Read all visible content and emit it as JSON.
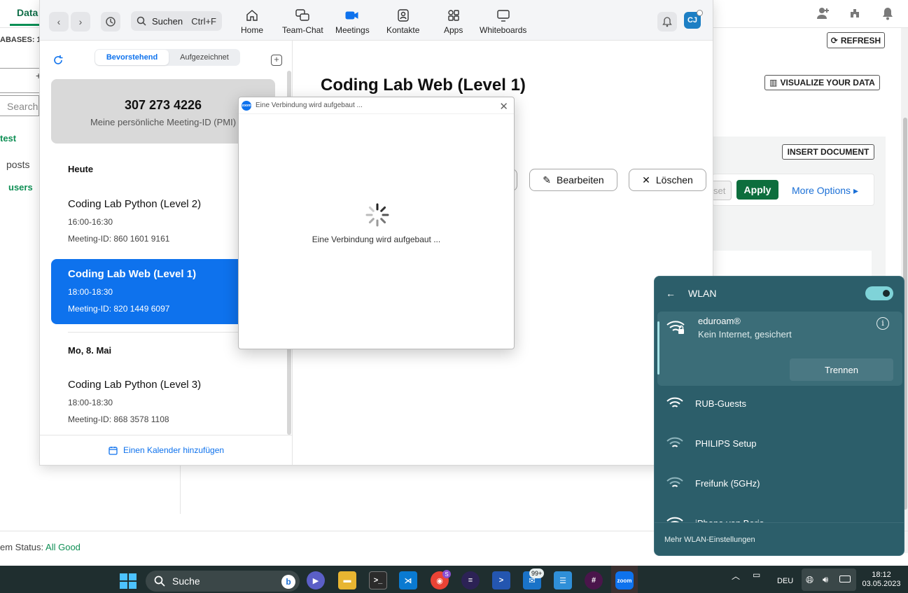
{
  "browser": {
    "tab_data": "Data",
    "databases_label": "ABASES: 1",
    "search_placeholder": "Search",
    "db_name": "test",
    "collections": [
      "posts",
      "users"
    ],
    "refresh_label": "REFRESH",
    "visualize_label": "VISUALIZE YOUR DATA",
    "insert_label": "INSERT DOCUMENT",
    "reset_label": "set",
    "apply_label": "Apply",
    "more_options_label": "More Options",
    "status_prefix": "em Status:",
    "status_value": "All Good"
  },
  "zoom": {
    "search_label": "Suchen",
    "search_shortcut": "Ctrl+F",
    "nav": [
      "Home",
      "Team-Chat",
      "Meetings",
      "Kontakte",
      "Apps",
      "Whiteboards"
    ],
    "avatar_initials": "CJ",
    "tabs": {
      "upcoming": "Bevorstehend",
      "recorded": "Aufgezeichnet"
    },
    "pmi": {
      "number": "307 273 4226",
      "label": "Meine persönliche Meeting-ID (PMI)"
    },
    "day1": "Heute",
    "day2": "Mo, 8. Mai",
    "meetings": [
      {
        "title": "Coding Lab Python (Level 2)",
        "time": "16:00-16:30",
        "id": "Meeting-ID: 860 1601 9161"
      },
      {
        "title": "Coding Lab Web (Level 1)",
        "time": "18:00-18:30",
        "id": "Meeting-ID: 820 1449 6097"
      },
      {
        "title": "Coding Lab Python (Level 3)",
        "time": "18:00-18:30",
        "id": "Meeting-ID: 868 3578 1108"
      }
    ],
    "add_calendar": "Einen Kalender hinzufügen",
    "detail_title": "Coding Lab Web (Level 1)",
    "edit_label": "Bearbeiten",
    "delete_label": "Löschen"
  },
  "dialog": {
    "title": "Eine Verbindung wird aufgebaut ...",
    "logo_text": "zoom",
    "message": "Eine Verbindung wird aufgebaut ..."
  },
  "wlan": {
    "title": "WLAN",
    "toggle_on": true,
    "active": {
      "name": "eduroam®",
      "status": "Kein Internet, gesichert",
      "disconnect": "Trennen"
    },
    "networks": [
      "RUB-Guests",
      "PHILIPS Setup",
      "Freifunk (5GHz)",
      "iPhone von Boris"
    ],
    "more_settings": "Mehr WLAN-Einstellungen"
  },
  "taskbar": {
    "search_label": "Suche",
    "mail_badge": "99+",
    "chrome_badge": "S",
    "zoom_label": "zoom",
    "language": "DEU",
    "time": "18:12",
    "date": "03.05.2023"
  },
  "colors": {
    "zoom_blue": "#0e72ed",
    "mongo_green": "#0d6e3d",
    "wlan_bg": "#2c5e6a",
    "taskbar_bg": "#1f2e2f"
  }
}
